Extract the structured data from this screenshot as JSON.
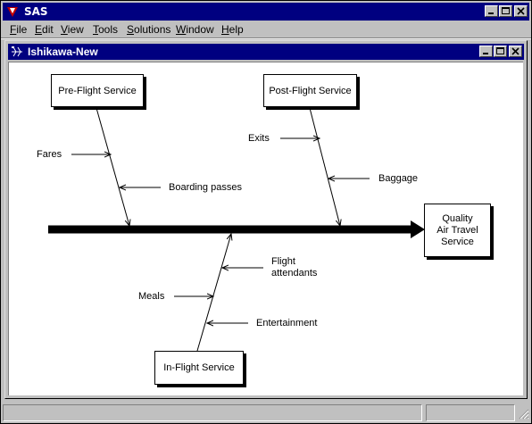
{
  "app": {
    "title": "SAS"
  },
  "menu": {
    "items": [
      {
        "u": "F",
        "rest": "ile"
      },
      {
        "u": "E",
        "rest": "dit"
      },
      {
        "u": "V",
        "rest": "iew"
      },
      {
        "u": "T",
        "rest": "ools"
      },
      {
        "u": "S",
        "rest": "olutions"
      },
      {
        "u": "W",
        "rest": "indow"
      },
      {
        "u": "H",
        "rest": "elp"
      }
    ]
  },
  "document": {
    "title": "Ishikawa-New"
  },
  "diagram": {
    "effect": [
      "Quality",
      "Air Travel",
      "Service"
    ],
    "categories": {
      "pre_flight": "Pre-Flight Service",
      "post_flight": "Post-Flight Service",
      "in_flight": "In-Flight Service"
    },
    "causes": {
      "fares": "Fares",
      "boarding_passes": "Boarding passes",
      "exits": "Exits",
      "baggage": "Baggage",
      "flight_attendants": [
        "Flight",
        "attendants"
      ],
      "meals": "Meals",
      "entertainment": "Entertainment"
    }
  },
  "colors": {
    "titlebar": "#000080",
    "face": "#c0c0c0",
    "canvas": "#ffffff"
  }
}
